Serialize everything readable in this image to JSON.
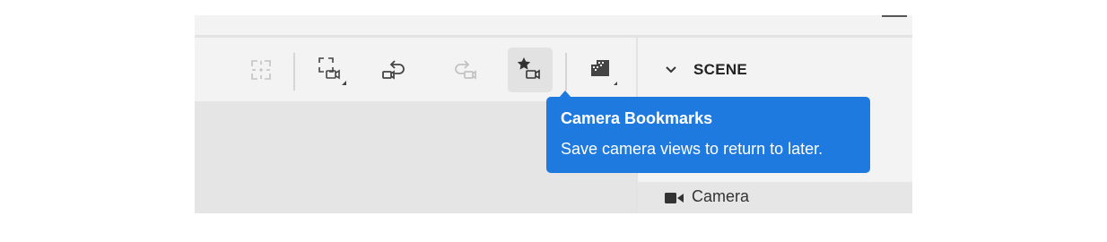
{
  "toolbar": {
    "tools": [
      {
        "name": "frame-selection",
        "icon": "frame-icon",
        "state": "disabled"
      },
      {
        "name": "frame-camera",
        "icon": "frame-camera-icon",
        "state": "enabled",
        "has_submenu": true
      },
      {
        "name": "undo-camera",
        "icon": "undo-camera-icon",
        "state": "enabled"
      },
      {
        "name": "redo-camera",
        "icon": "redo-camera-icon",
        "state": "disabled"
      },
      {
        "name": "camera-bookmarks",
        "icon": "star-camera-icon",
        "state": "active"
      },
      {
        "name": "render-preview",
        "icon": "render-icon",
        "state": "enabled",
        "has_submenu": true
      }
    ]
  },
  "panel": {
    "section_title": "SCENE",
    "section_expanded": true,
    "items": [
      {
        "label": "Camera",
        "icon": "camera-icon"
      }
    ]
  },
  "tooltip": {
    "title": "Camera Bookmarks",
    "body": "Save camera views to return to later."
  },
  "colors": {
    "accent": "#1f7ae0",
    "background": "#f3f3f3",
    "viewport": "#e5e5e5"
  }
}
